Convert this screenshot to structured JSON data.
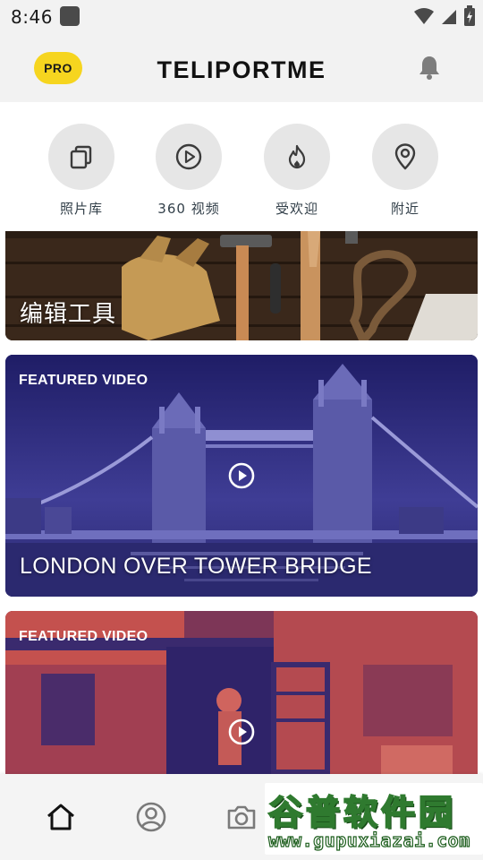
{
  "status_bar": {
    "time": "8:46"
  },
  "app_bar": {
    "pro_label": "PRO",
    "title": "TELIPORTME",
    "bell_icon": "bell-icon"
  },
  "categories": [
    {
      "label": "照片库",
      "icon": "gallery-icon"
    },
    {
      "label": "360 视频",
      "icon": "play-circle-icon"
    },
    {
      "label": "受欢迎",
      "icon": "flame-icon"
    },
    {
      "label": "附近",
      "icon": "location-pin-icon"
    }
  ],
  "cards": {
    "tools": {
      "title": "编辑工具"
    },
    "bridge": {
      "tag": "FEATURED VIDEO",
      "title": "LONDON OVER TOWER BRIDGE"
    },
    "market": {
      "tag": "FEATURED VIDEO"
    }
  },
  "bottom_nav": {
    "items": [
      "home-icon",
      "profile-icon",
      "camera-icon"
    ]
  },
  "watermark": {
    "line1": "谷普软件园",
    "line2": "www.gupuxiazai.com"
  },
  "colors": {
    "pro_badge": "#f6d51f",
    "header_bg": "#f2f2f2",
    "category_circle": "#e6e6e6"
  }
}
